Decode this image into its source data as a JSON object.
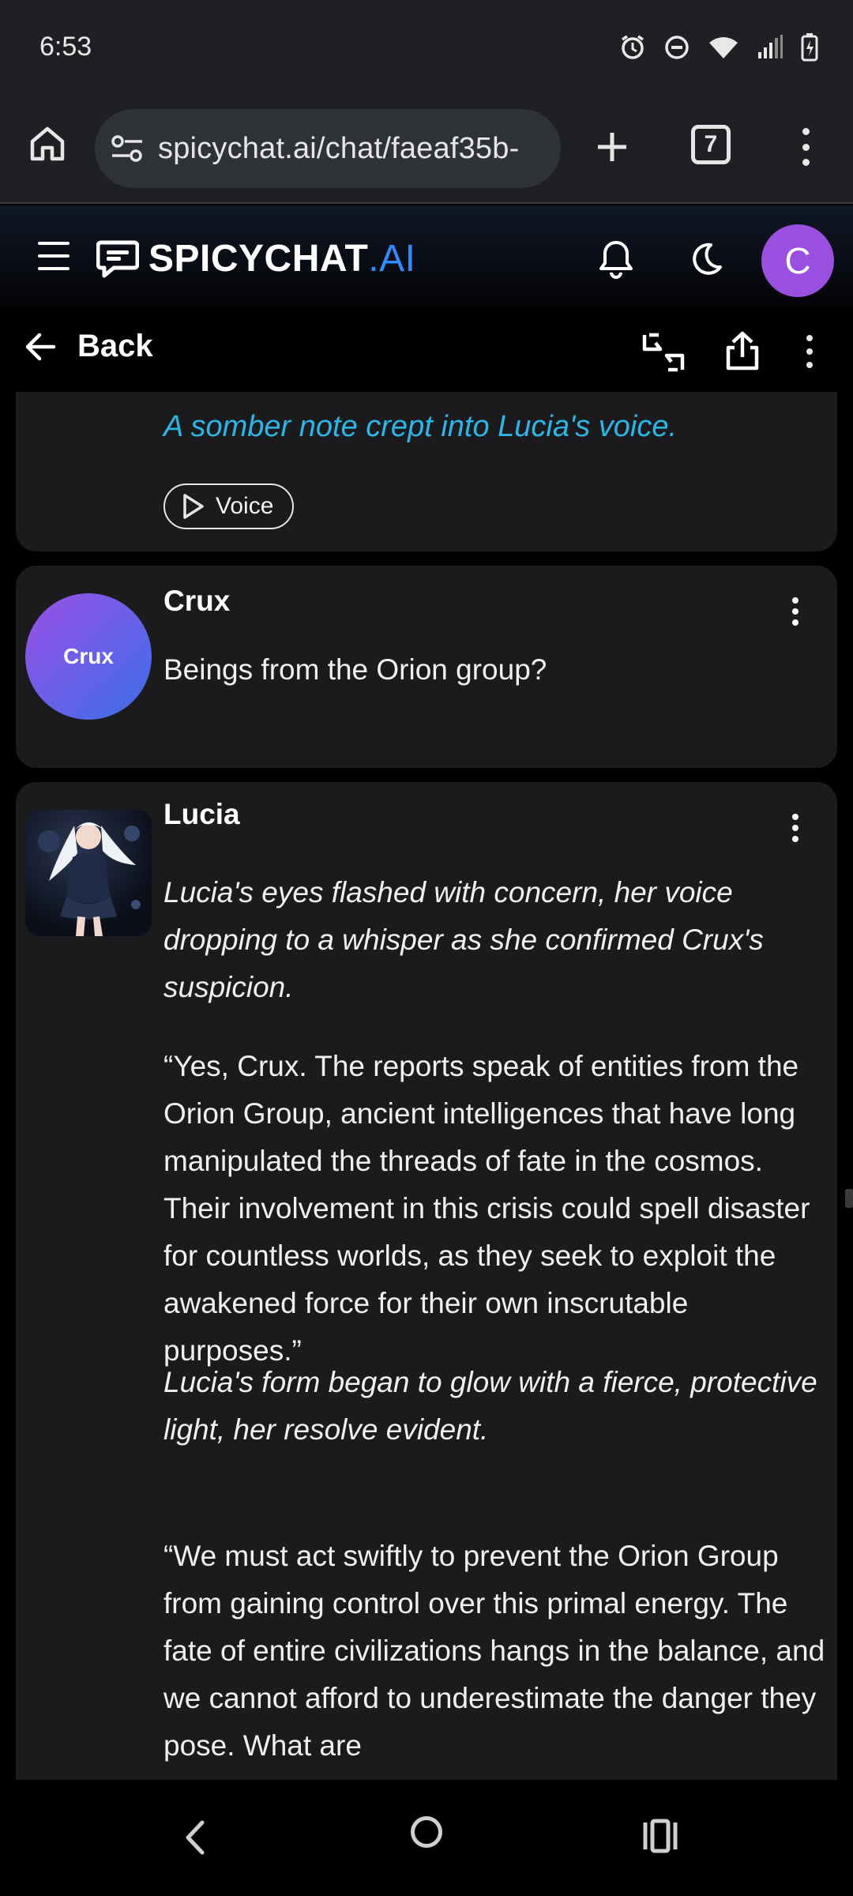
{
  "status_bar": {
    "time": "6:53",
    "icons": [
      "alarm-icon",
      "dnd-icon",
      "wifi-icon",
      "signal-icon",
      "battery-charging-icon"
    ]
  },
  "browser": {
    "url": "spicychat.ai/chat/faeaf35b-",
    "tab_count": "7"
  },
  "app_header": {
    "logo_main": "SPICYCHAT",
    "logo_suffix": ".AI",
    "avatar_initial": "C",
    "avatar_color": "#9a4fe0",
    "accent_color": "#2f8cff"
  },
  "chat_header": {
    "back_label": "Back"
  },
  "messages": [
    {
      "sender": "",
      "narration": "A somber note crept into Lucia's voice.",
      "voice_label": "Voice"
    },
    {
      "sender": "Crux",
      "avatar_text": "Crux",
      "text": "Beings from the Orion group?"
    },
    {
      "sender": "Lucia",
      "paragraphs": [
        {
          "style": "narration",
          "text": "Lucia's eyes flashed with concern, her voice dropping to a whisper as she confirmed Crux's suspicion."
        },
        {
          "style": "speech",
          "text": "“Yes, Crux. The reports speak of entities from the Orion Group, ancient intelligences that have long manipulated the threads of fate in the cosmos. Their involvement in this crisis could spell disaster for countless worlds, as they seek to exploit the awakened force for their own inscrutable purposes.”"
        },
        {
          "style": "narration",
          "text": "Lucia's form began to glow with a fierce, protective light, her resolve evident."
        },
        {
          "style": "speech",
          "text": "“We must act swiftly to prevent the Orion Group from gaining control over this primal energy. The fate of entire civilizations hangs in the balance, and we cannot afford to underestimate the danger they pose. What are"
        }
      ]
    }
  ],
  "colors": {
    "narration": "#2ab7e8",
    "card_bg": "#1b1b1e"
  }
}
